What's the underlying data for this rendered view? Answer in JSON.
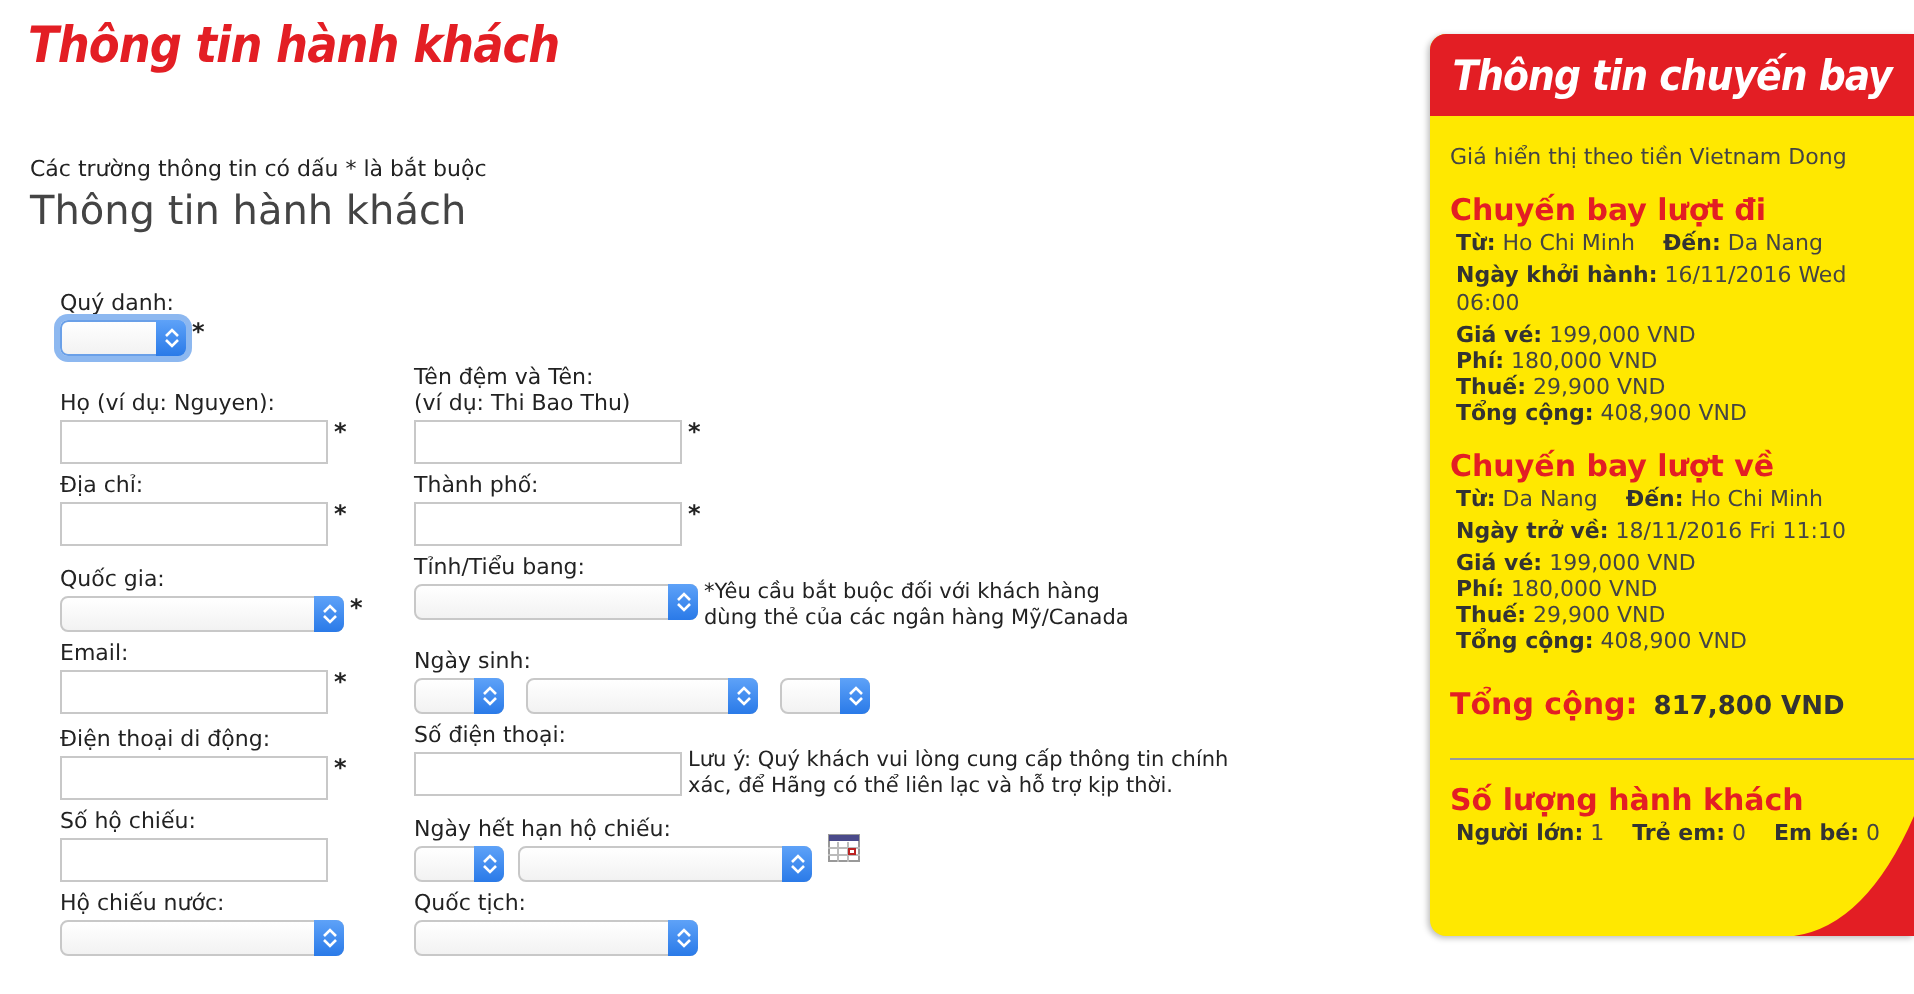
{
  "page_title": "Thông tin hành khách",
  "required_note": "Các trường thông tin có dấu * là bắt buộc",
  "section_title": "Thông tin hành khách",
  "form": {
    "rows": [
      {
        "left": {
          "label": "Quý danh:",
          "controls": [
            {
              "kind": "short-select",
              "focused": true
            }
          ],
          "required_mark": "*"
        },
        "right": null
      },
      {
        "left": {
          "label": "Họ (ví dụ: Nguyen):",
          "controls": [
            {
              "kind": "text"
            }
          ],
          "required_mark": "*"
        },
        "right": {
          "label": "Tên đệm và Tên:\n(ví dụ: Thi Bao Thu)",
          "controls": [
            {
              "kind": "text"
            }
          ],
          "required_mark": "*"
        }
      },
      {
        "left": {
          "label": "Địa chỉ:",
          "controls": [
            {
              "kind": "text"
            }
          ],
          "required_mark": "*"
        },
        "right": {
          "label": "Thành phố:",
          "controls": [
            {
              "kind": "text"
            }
          ],
          "required_mark": "*"
        }
      },
      {
        "left": {
          "label": "Quốc gia:",
          "controls": [
            {
              "kind": "select"
            }
          ],
          "required_mark": "*"
        },
        "right": {
          "label": "Tỉnh/Tiểu bang:",
          "controls": [
            {
              "kind": "select"
            }
          ],
          "note": "*Yêu cầu bắt buộc đối với khách hàng\ndùng thẻ của các ngân hàng Mỹ/Canada"
        }
      },
      {
        "left": {
          "label": "Email:",
          "controls": [
            {
              "kind": "text"
            }
          ],
          "required_mark": "*"
        },
        "right": {
          "label": "Ngày sinh:",
          "controls": [
            {
              "kind": "short-select"
            },
            {
              "kind": "medium-select"
            },
            {
              "kind": "short-select"
            }
          ]
        }
      },
      {
        "left": {
          "label": "Điện thoại di động:",
          "controls": [
            {
              "kind": "text"
            }
          ],
          "required_mark": "*"
        },
        "right": {
          "label": "Số điện thoại:",
          "controls": [
            {
              "kind": "text"
            }
          ],
          "note": "Lưu ý: Quý khách vui lòng cung cấp thông tin chính\nxác, để Hãng có thể liên lạc và hỗ trợ kịp thời."
        }
      },
      {
        "left": {
          "label": "Số hộ chiếu:",
          "controls": [
            {
              "kind": "text"
            }
          ]
        },
        "right": {
          "label": "Ngày hết hạn hộ chiếu:",
          "controls": [
            {
              "kind": "short-select"
            },
            {
              "kind": "long-select"
            },
            {
              "kind": "calendar"
            }
          ]
        }
      },
      {
        "left": {
          "label": "Hộ chiếu nước:",
          "controls": [
            {
              "kind": "select"
            }
          ]
        },
        "right": {
          "label": "Quốc tịch:",
          "controls": [
            {
              "kind": "select"
            }
          ]
        }
      }
    ]
  },
  "flight_panel": {
    "title": "Thông tin chuyến bay",
    "currency_note": "Giá hiển thị theo tiền Vietnam Dong",
    "flights": [
      {
        "heading": "Chuyến bay lượt đi",
        "route": [
          "**Từ:** Ho Chi Minh",
          "**Đến:** Da Nang"
        ],
        "date": "**Ngày khởi hành:** 16/11/2016 Wed 06:00",
        "prices": [
          "**Giá vé:** 199,000 VND",
          "**Phí:** 180,000 VND",
          "**Thuế:** 29,900 VND",
          "**Tổng cộng:** 408,900 VND"
        ]
      },
      {
        "heading": "Chuyến bay lượt về",
        "route": [
          "**Từ:** Da Nang",
          "**Đến:** Ho Chi Minh"
        ],
        "date": "**Ngày trở về:** 18/11/2016 Fri 11:10",
        "prices": [
          "**Giá vé:** 199,000 VND",
          "**Phí:** 180,000 VND",
          "**Thuế:** 29,900 VND",
          "**Tổng cộng:** 408,900 VND"
        ]
      }
    ],
    "total_label": "Tổng cộng:",
    "total_value": "817,800 VND",
    "passengers_heading": "Số lượng hành khách",
    "passengers": [
      "**Người lớn:** 1",
      "**Trẻ em:** 0",
      "**Em bé:** 0"
    ]
  }
}
